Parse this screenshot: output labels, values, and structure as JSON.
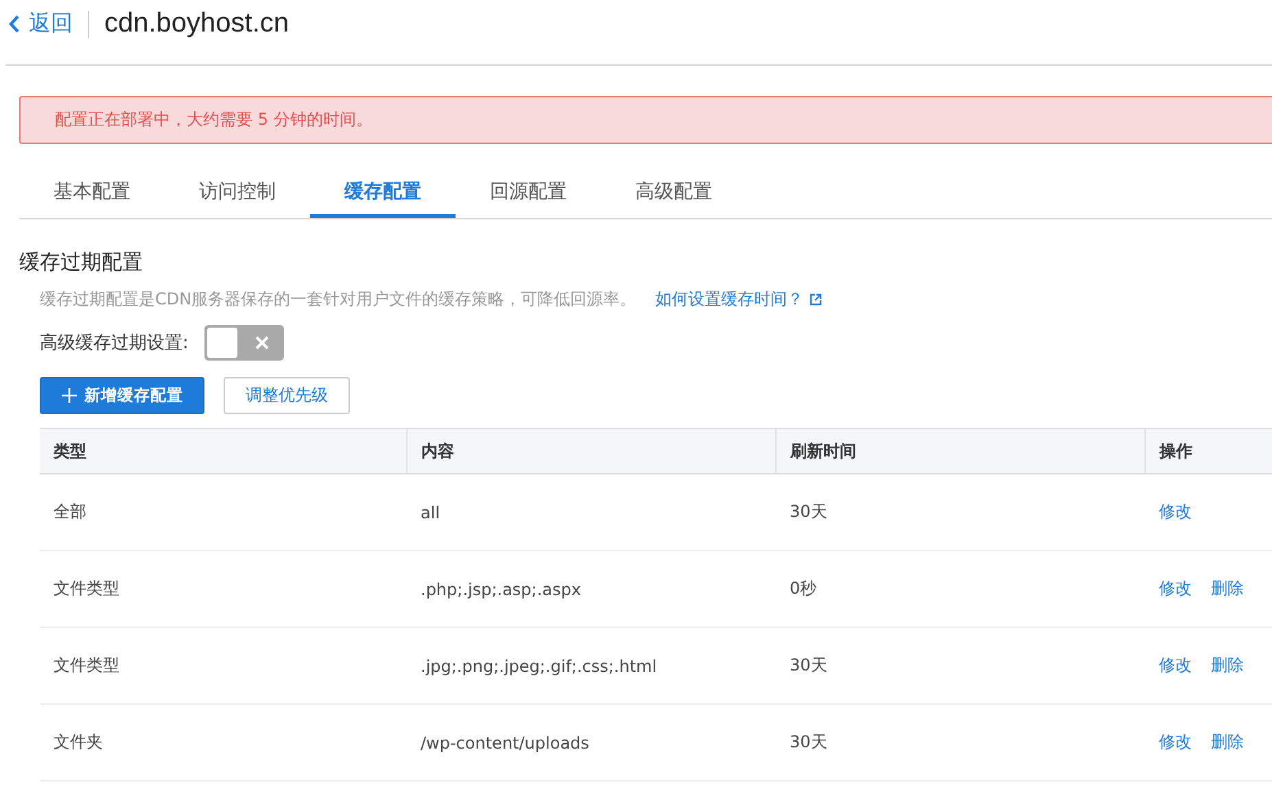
{
  "header": {
    "back": "返回",
    "title": "cdn.boyhost.cn"
  },
  "alert": "配置正在部署中，大约需要 5 分钟的时间。",
  "tabs": [
    {
      "label": "基本配置",
      "selected": false
    },
    {
      "label": "访问控制",
      "selected": false
    },
    {
      "label": "缓存配置",
      "selected": true
    },
    {
      "label": "回源配置",
      "selected": false
    },
    {
      "label": "高级配置",
      "selected": false
    }
  ],
  "section": {
    "title": "缓存过期配置",
    "description": "缓存过期配置是CDN服务器保存的一套针对用户文件的缓存策略，可降低回源率。",
    "help_link": "如何设置缓存时间？"
  },
  "advanced_toggle": {
    "label": "高级缓存过期设置:",
    "on": false
  },
  "buttons": {
    "add": "新增缓存配置",
    "priority": "调整优先级"
  },
  "table": {
    "columns": [
      "类型",
      "内容",
      "刷新时间",
      "操作"
    ],
    "rows": [
      {
        "type": "全部",
        "content": "all",
        "ttl": "30天",
        "actions": [
          "修改"
        ]
      },
      {
        "type": "文件类型",
        "content": ".php;.jsp;.asp;.aspx",
        "ttl": "0秒",
        "actions": [
          "修改",
          "删除"
        ]
      },
      {
        "type": "文件类型",
        "content": ".jpg;.png;.jpeg;.gif;.css;.html",
        "ttl": "30天",
        "actions": [
          "修改",
          "删除"
        ]
      },
      {
        "type": "文件夹",
        "content": "/wp-content/uploads",
        "ttl": "30天",
        "actions": [
          "修改",
          "删除"
        ]
      }
    ]
  }
}
